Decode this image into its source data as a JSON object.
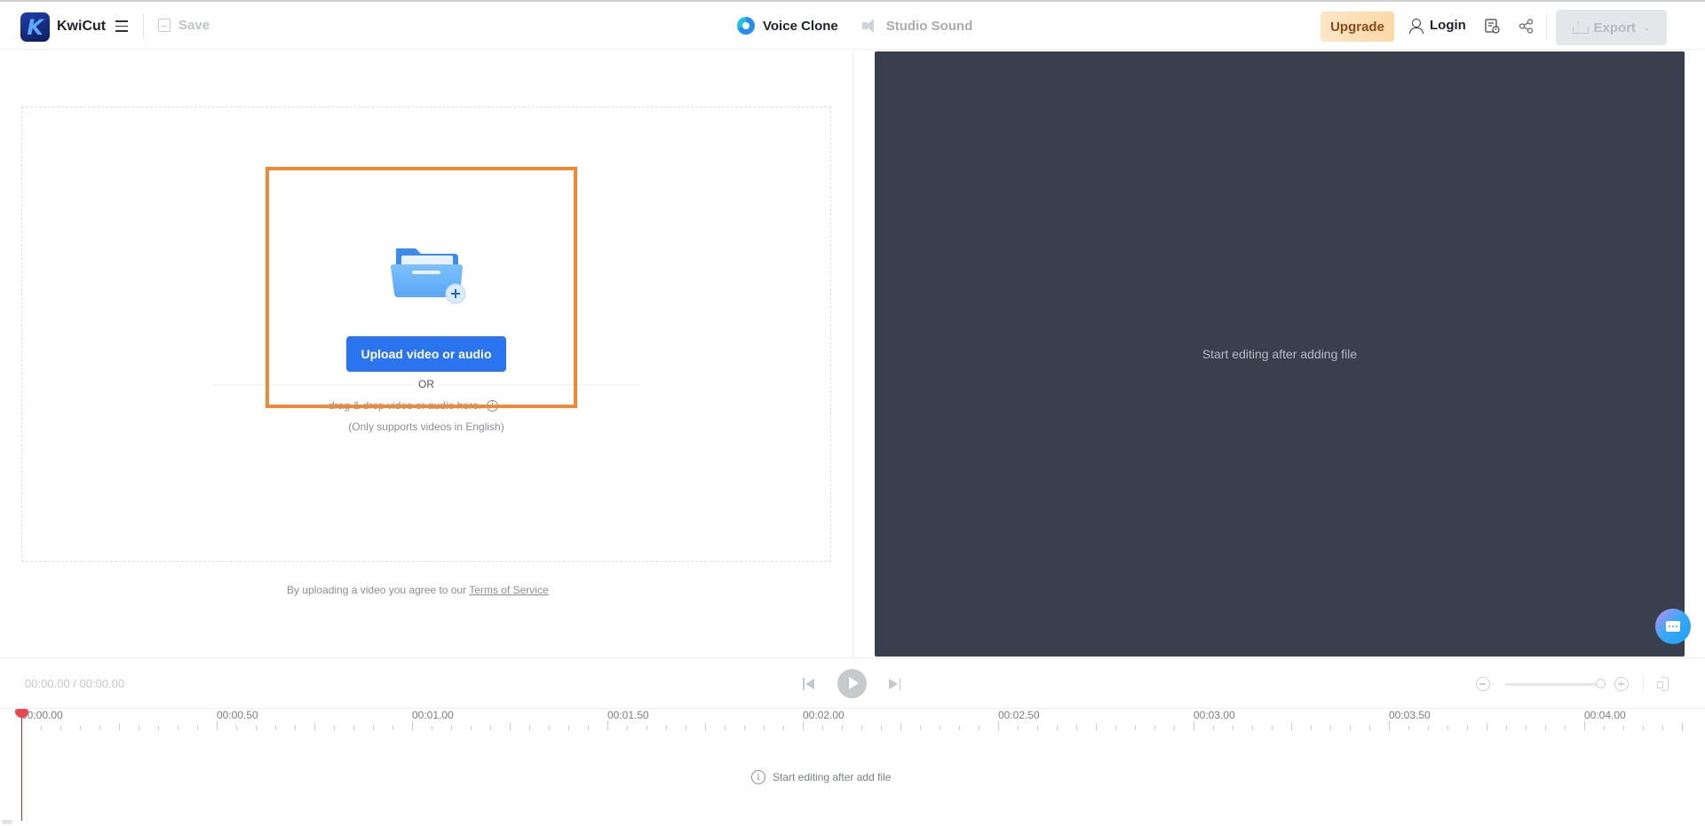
{
  "header": {
    "brand": "KwiCut",
    "logo_letter": "K",
    "save_label": "Save",
    "tabs": [
      {
        "label": "Voice Clone",
        "icon": "voice-clone-icon",
        "active": true
      },
      {
        "label": "Studio Sound",
        "icon": "speaker-icon",
        "active": false
      }
    ],
    "upgrade_label": "Upgrade",
    "login_label": "Login",
    "export_label": "Export"
  },
  "upload": {
    "button_label": "Upload video or audio",
    "or_label": "OR",
    "drag_text": "drag & drop video or audio here.",
    "info_glyph": "i",
    "language_note": "(Only supports videos in English)",
    "terms_prefix": "By uploading a video you agree to our",
    "terms_link": "Terms of Service",
    "highlight_color": "#ec8a3a"
  },
  "preview": {
    "placeholder": "Start editing after adding file"
  },
  "player": {
    "current_time": "00:00.00",
    "separator": "/",
    "total_time": "00:00.00",
    "zoom_level": 1.0
  },
  "timeline": {
    "labels": [
      "00:00.00",
      "00:00.50",
      "00:01.00",
      "00:01.50",
      "00:02.00",
      "00:02.50",
      "00:03.00",
      "00:03.50",
      "00:04.00"
    ],
    "empty_text": "Start editing after add file",
    "info_glyph": "i"
  },
  "colors": {
    "primary": "#2b74f0",
    "preview_bg": "#3a3f4d",
    "playhead": "#e8484f"
  }
}
